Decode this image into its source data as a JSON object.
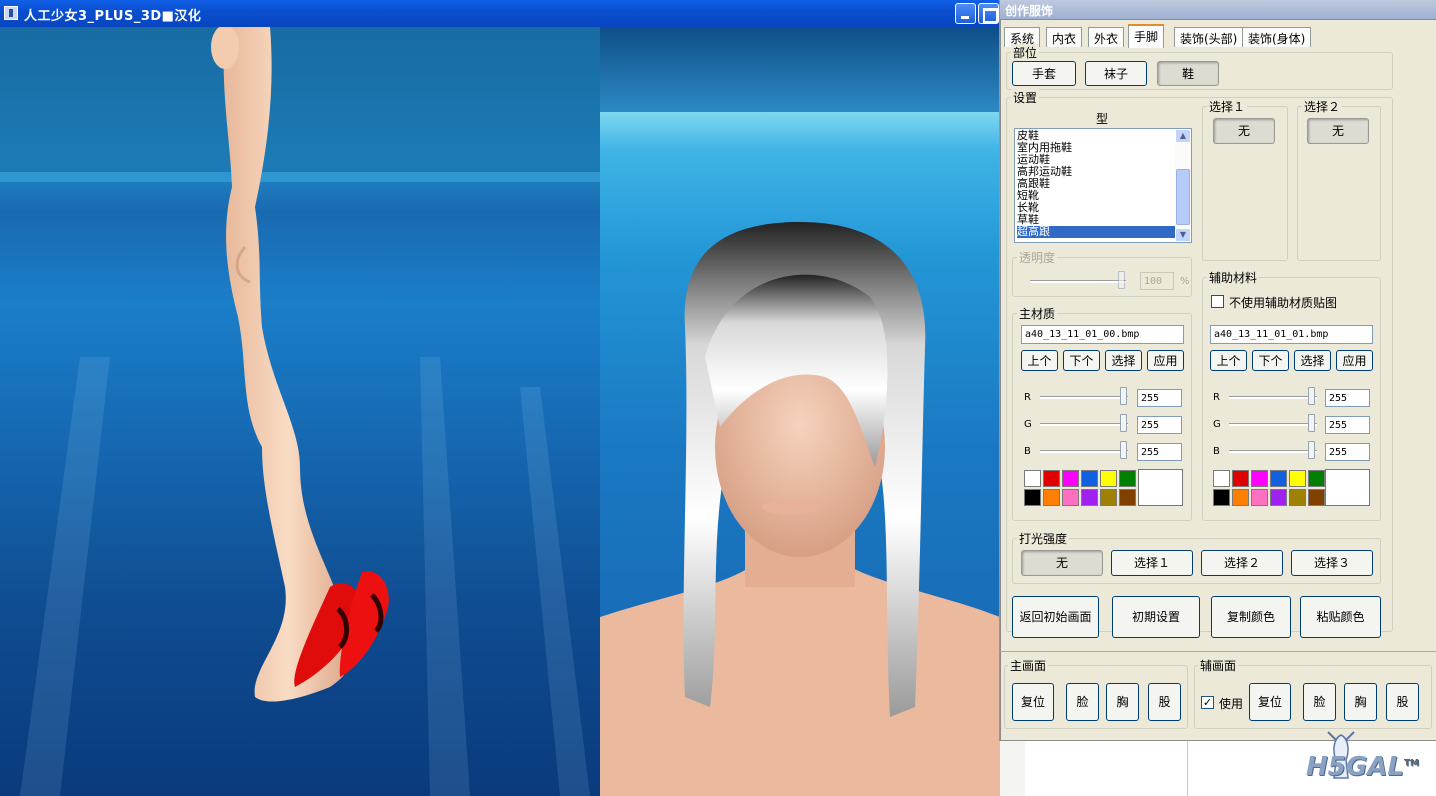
{
  "window": {
    "title": "人工少女3_PLUS_3D■汉化"
  },
  "dialog": {
    "title": "创作服饰",
    "tabs": [
      "系统",
      "内衣",
      "外衣",
      "手脚",
      "装饰(头部)",
      "装饰(身体)"
    ],
    "active_tab": "手脚",
    "part": {
      "label": "部位",
      "buttons": [
        "手套",
        "袜子",
        "鞋"
      ],
      "selected": "鞋"
    },
    "settings": {
      "label": "设置",
      "type_header": "型",
      "types": [
        "皮鞋",
        "室内用拖鞋",
        "运动鞋",
        "高邦运动鞋",
        "高跟鞋",
        "短靴",
        "长靴",
        "草鞋",
        "超高跟"
      ],
      "selected_type": "超高跟"
    },
    "select1": {
      "label": "选择１",
      "value": "无"
    },
    "select2": {
      "label": "选择２",
      "value": "无"
    },
    "opacity": {
      "label": "透明度",
      "value": "100",
      "unit": "%"
    },
    "main_material": {
      "label": "主材质",
      "file": "a40_13_11_01_00.bmp",
      "buttons": [
        "上个",
        "下个",
        "选择",
        "应用"
      ],
      "rgb": [
        {
          "channel": "R",
          "value": "255"
        },
        {
          "channel": "G",
          "value": "255"
        },
        {
          "channel": "B",
          "value": "255"
        }
      ]
    },
    "aux_material": {
      "label": "辅助材料",
      "checkbox_label": "不使用辅助材质贴图",
      "checked": false,
      "file": "a40_13_11_01_01.bmp",
      "buttons": [
        "上个",
        "下个",
        "选择",
        "应用"
      ],
      "rgb": [
        {
          "channel": "R",
          "value": "255"
        },
        {
          "channel": "G",
          "value": "255"
        },
        {
          "channel": "B",
          "value": "255"
        }
      ]
    },
    "palette": [
      "#ffffff",
      "#e00000",
      "#ff00ff",
      "#1060e0",
      "#ffff00",
      "#008000",
      "#000000",
      "#ff8000",
      "#ff70c0",
      "#a020f0",
      "#a08000",
      "#804000"
    ],
    "lighting": {
      "label": "打光强度",
      "buttons": [
        "无",
        "选择１",
        "选择２",
        "选择３"
      ],
      "selected": "无"
    },
    "actions": [
      "返回初始画面",
      "初期设置",
      "复制颜色",
      "粘贴颜色"
    ],
    "main_screen": {
      "label": "主画面",
      "buttons": [
        "复位",
        "脸",
        "胸",
        "股"
      ]
    },
    "sub_screen": {
      "label": "辅画面",
      "use_label": "使用",
      "use_checked": true,
      "buttons": [
        "复位",
        "脸",
        "胸",
        "股"
      ]
    }
  },
  "watermark": {
    "text": "H5GAL",
    "tm": "TM"
  }
}
